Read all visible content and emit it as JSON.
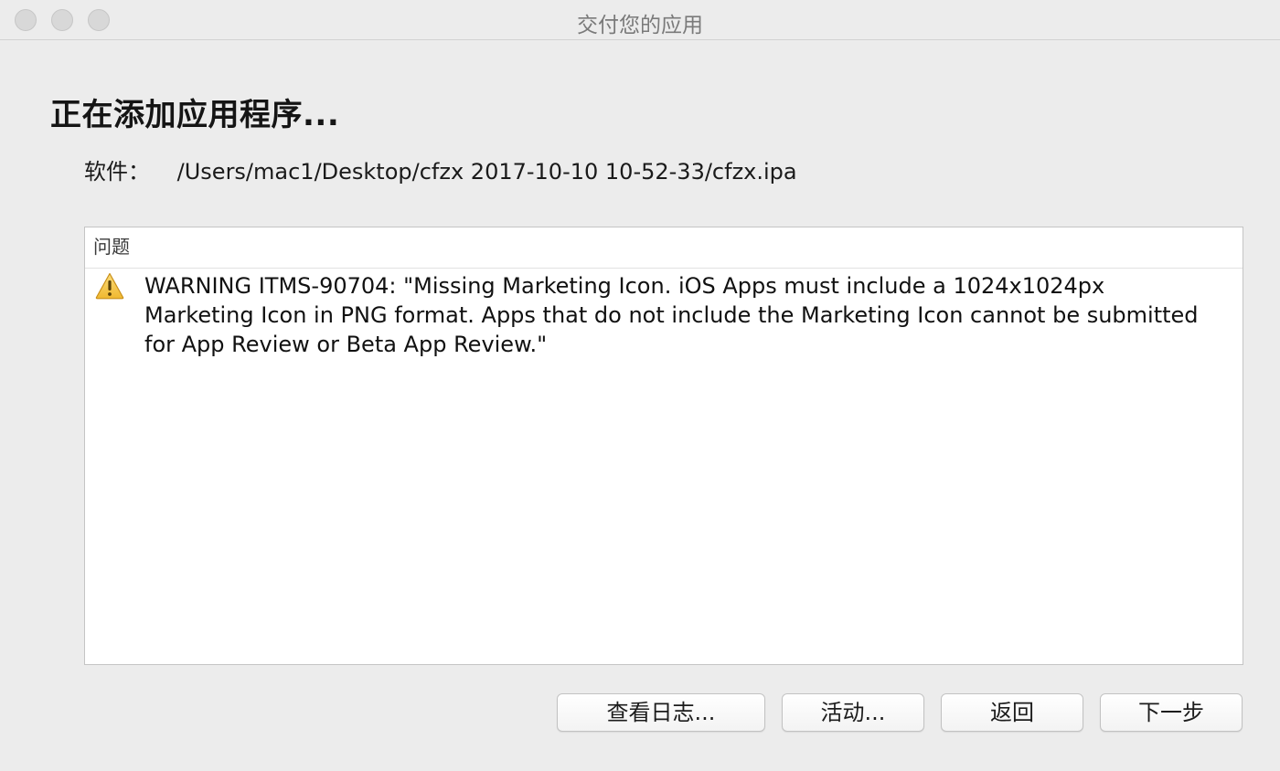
{
  "window": {
    "title": "交付您的应用"
  },
  "heading": "正在添加应用程序...",
  "software": {
    "label": "软件：",
    "path": "/Users/mac1/Desktop/cfzx 2017-10-10 10-52-33/cfzx.ipa"
  },
  "issues": {
    "header": "问题",
    "items": [
      {
        "icon": "warning-triangle-icon",
        "text": "WARNING ITMS-90704: \"Missing Marketing Icon. iOS Apps must include a 1024x1024px Marketing Icon in PNG format. Apps that do not include the Marketing Icon cannot be submitted for App Review or Beta App Review.\""
      }
    ]
  },
  "buttons": {
    "view_log": "查看日志...",
    "activity": "活动...",
    "back": "返回",
    "next": "下一步"
  },
  "colors": {
    "window_bg": "#ececec",
    "warning_yellow": "#f5c542"
  }
}
